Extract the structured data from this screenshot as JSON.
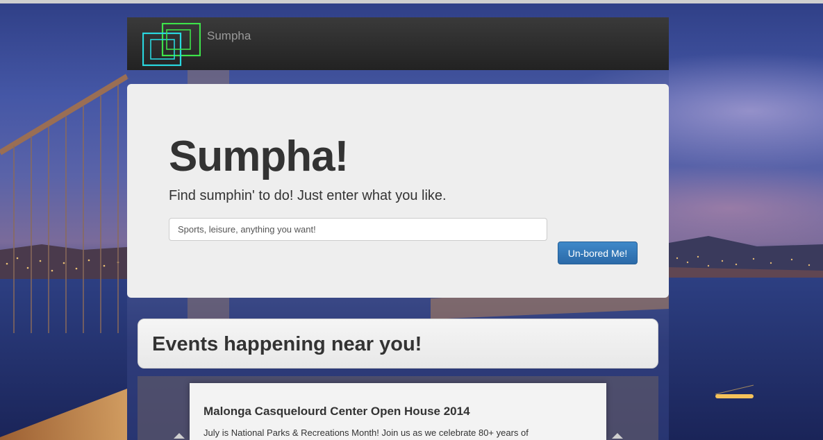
{
  "navbar": {
    "brand": "Sumpha"
  },
  "hero": {
    "title": "Sumpha!",
    "subtitle": "Find sumphin' to do! Just enter what you like.",
    "search_placeholder": "Sports, leisure, anything you want!",
    "search_value": "",
    "button_label": "Un-bored Me!",
    "button_color": "#337ab7"
  },
  "events": {
    "heading": "Events happening near you!",
    "items": [
      {
        "title": "Malonga Casquelourd Center Open House 2014",
        "description": "July is National Parks & Recreations Month! Join us as we celebrate 80+ years of"
      }
    ]
  },
  "colors": {
    "logo_green": "#3ee24a",
    "logo_cyan": "#29d8e0",
    "navbar_bg": "#2a2a2a"
  }
}
